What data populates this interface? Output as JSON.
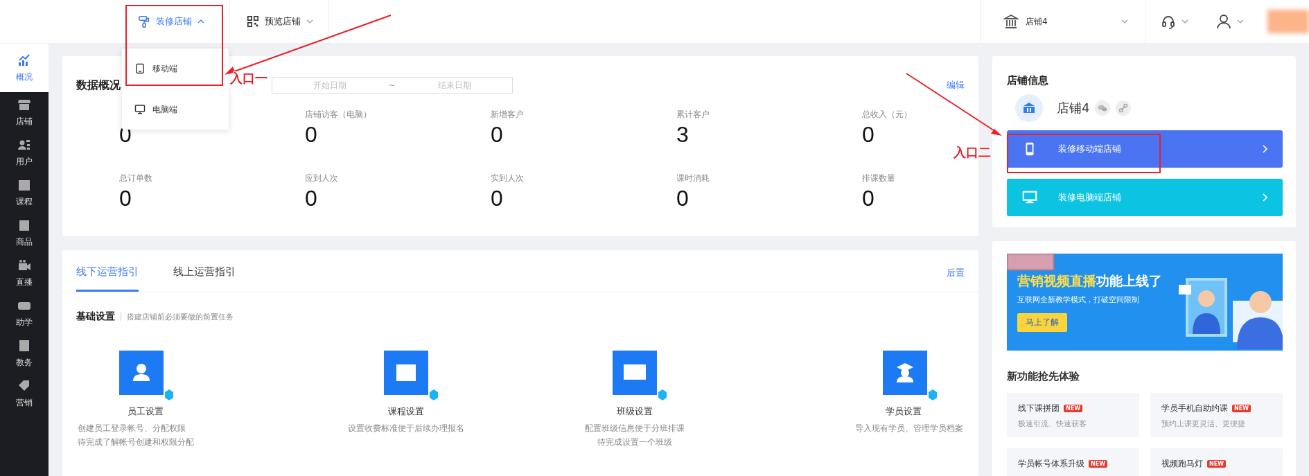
{
  "topbar": {
    "menus": [
      {
        "label": "装修店铺",
        "expanded": true
      },
      {
        "label": "预览店铺",
        "expanded": false
      }
    ],
    "store_select": {
      "value": "店铺4"
    }
  },
  "dropdown": [
    {
      "label": "移动端"
    },
    {
      "label": "电脑端"
    }
  ],
  "sidebar": [
    {
      "label": "概况",
      "selected": true
    },
    {
      "label": "店铺",
      "selected": false
    },
    {
      "label": "用户",
      "selected": false
    },
    {
      "label": "课程",
      "selected": false
    },
    {
      "label": "商品",
      "selected": false
    },
    {
      "label": "直播",
      "selected": false
    },
    {
      "label": "助学",
      "selected": false
    },
    {
      "label": "教务",
      "selected": false
    },
    {
      "label": "营销",
      "selected": false
    }
  ],
  "overview": {
    "title": "数据概况",
    "date_start": {
      "placeholder": "开始日期"
    },
    "date_sep": "~",
    "date_end": {
      "placeholder": "结束日期"
    },
    "edit": "编辑",
    "stats": [
      {
        "value": "0"
      },
      {
        "label": "店铺访客（电脑）",
        "value": "0"
      },
      {
        "label": "新增客户",
        "value": "0"
      },
      {
        "label": "累计客户",
        "value": "3"
      },
      {
        "label": "总收入（元）",
        "value": "0"
      },
      {
        "label": "总订单数",
        "value": "0"
      },
      {
        "label": "应到人次",
        "value": "0"
      },
      {
        "label": "实到人次",
        "value": "0"
      },
      {
        "label": "课时消耗",
        "value": "0"
      },
      {
        "label": "排课数量",
        "value": "0"
      }
    ]
  },
  "guide": {
    "tabs": [
      {
        "label": "线下运营指引",
        "selected": true
      },
      {
        "label": "线上运营指引",
        "selected": false
      }
    ],
    "action": "后置",
    "section_title": "基础设置",
    "section_hint": "搭建店铺前必须要做的前置任务",
    "tasks": [
      {
        "title": "员工设置",
        "lines": [
          "创建员工登录帐号、分配权限",
          "待完成了解帐号创建和权限分配"
        ]
      },
      {
        "title": "课程设置",
        "lines": [
          "设置收费标准便于后续办理报名"
        ]
      },
      {
        "title": "班级设置",
        "lines": [
          "配置班级信息便于分班排课",
          "待完成设置一个班级"
        ]
      },
      {
        "title": "学员设置",
        "lines": [
          "导入现有学员、管理学员档案"
        ]
      }
    ]
  },
  "store_info": {
    "title": "店铺信息",
    "name": "店铺4",
    "buttons": [
      {
        "label": "装修移动端店铺",
        "color": "#4a74f2"
      },
      {
        "label": "装修电脑端店铺",
        "color": "#0cc3e2"
      }
    ]
  },
  "banner": {
    "headline_highlight": "营销视频直播",
    "headline_rest": "功能上线了",
    "subtitle": "互联网全新教学模式，打破空间限制",
    "button": "马上了解"
  },
  "features": {
    "title": "新功能抢先体验",
    "items": [
      {
        "title": "线下课拼团",
        "badge": "NEW",
        "desc": "极速引流、快速获客"
      },
      {
        "title": "学员手机自助约课",
        "badge": "NEW",
        "desc": "预约上课更灵活、更便捷"
      },
      {
        "title": "学员帐号体系升级",
        "badge": "NEW"
      },
      {
        "title": "视频跑马灯",
        "badge": "NEW"
      }
    ]
  },
  "annotations": [
    {
      "text": "入口一"
    },
    {
      "text": "入口二"
    }
  ]
}
